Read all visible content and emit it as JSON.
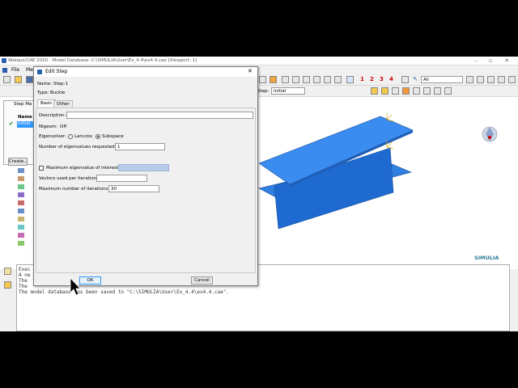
{
  "app": {
    "title": "Abaqus/CAE 2020 - Model Database: C:\\SIMULIA\\User\\Ex_4.4\\ex4.4.cae [Viewport: 1]",
    "menu": [
      "File",
      "Me"
    ],
    "toolbar_numbers": [
      "1",
      "2",
      "3",
      "4"
    ],
    "filter_select": "All",
    "step_label": "Step:",
    "step_value": "Initial",
    "brand": "SIMULIA"
  },
  "left_panel": {
    "step_manager_title": "Step Ma",
    "name_header": "Name",
    "initial_item": "Initial",
    "create_label": "Create..."
  },
  "dialog": {
    "title": "Edit Step",
    "name_label": "Name:",
    "name_value": "Step-1",
    "type_label": "Type:",
    "type_value": "Buckle",
    "tab_basic": "Basic",
    "tab_other": "Other",
    "description_label": "Description:",
    "description_value": "",
    "nlgeom_label": "Nlgeom:",
    "nlgeom_value": "Off",
    "eigensolver_label": "Eigensolver:",
    "solver_lanczos": "Lanczos",
    "solver_subspace": "Subspace",
    "selected_solver": "Subspace",
    "num_eigen_label": "Number of eigenvalues requested:",
    "num_eigen_value": "1",
    "max_eigen_label": "Maximum eigenvalue of interest:",
    "max_eigen_checked": false,
    "vectors_label": "Vectors used per iteration:",
    "vectors_value": "",
    "max_iter_label": "Maximum number of iterations:",
    "max_iter_value": "30",
    "ok_label": "OK",
    "cancel_label": "Cancel"
  },
  "messages": {
    "lines": [
      "Exec",
      "A ne",
      "The ",
      "The ",
      "The model database has been saved to \"C:\\SIMULIA\\User\\Ex_4.4\\ex4.4.cae\"."
    ]
  },
  "colors": {
    "beam": "#2f7fe0",
    "beam_dark": "#1f5fb8",
    "accent_red": "#d00000",
    "selection_blue": "#3399ff"
  }
}
